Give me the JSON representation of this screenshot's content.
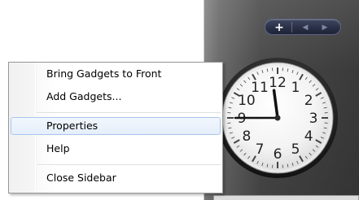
{
  "sidebar": {
    "controls": {
      "add_glyph": "+",
      "prev_glyph": "◀",
      "next_glyph": "▶"
    }
  },
  "clock": {
    "numerals": [
      "12",
      "1",
      "2",
      "3",
      "4",
      "5",
      "6",
      "7",
      "8",
      "9",
      "10",
      "11"
    ],
    "time_hours": 11,
    "time_minutes": 45
  },
  "context_menu": {
    "items": [
      {
        "label": "Bring Gadgets to Front"
      },
      {
        "label": "Add Gadgets..."
      },
      {
        "label": "Properties"
      },
      {
        "label": "Help"
      },
      {
        "label": "Close Sidebar"
      }
    ]
  }
}
